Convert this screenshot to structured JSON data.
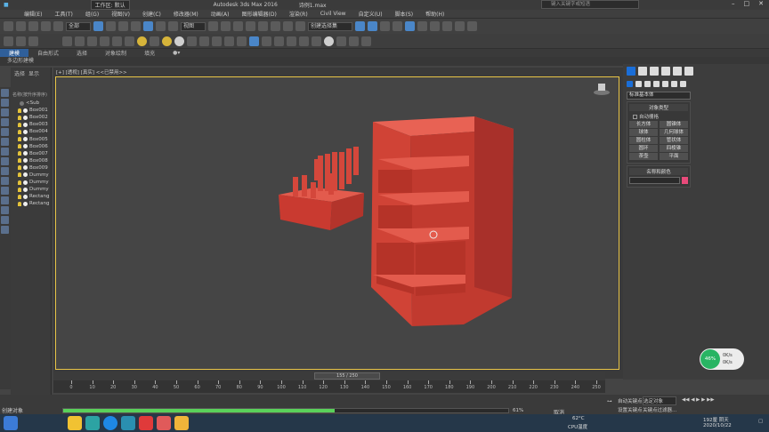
{
  "title_bar": {
    "workspace_label": "工作区: 默认",
    "app_title": "Autodesk 3ds Max 2016",
    "file_name": "诗例1.max",
    "search_placeholder": "键入关键字或短语"
  },
  "menu": [
    "编辑(E)",
    "工具(T)",
    "组(G)",
    "视图(V)",
    "创建(C)",
    "修改器(M)",
    "动画(A)",
    "图形编辑器(D)",
    "渲染(R)",
    "Civil View",
    "自定义(U)",
    "脚本(S)",
    "帮助(H)"
  ],
  "toolbar": {
    "selection_filter": "全部",
    "ref_coord": "视图",
    "named_selection": "创建选择集"
  },
  "ribbon": {
    "tabs": [
      "建模",
      "自由形式",
      "选择",
      "对象绘制",
      "填充"
    ],
    "active_tab": "建模",
    "subtitle": "多边形建模"
  },
  "scene_explorer": {
    "menu": [
      "选择",
      "显示"
    ],
    "column_header": "名称(按升序排序)",
    "items": [
      "<Sub",
      "Box001",
      "Box002",
      "Box003",
      "Box004",
      "Box005",
      "Box006",
      "Box007",
      "Box008",
      "Box009",
      "Dummy",
      "Dummy",
      "Dummy",
      "Rectang",
      "Rectang"
    ]
  },
  "viewport": {
    "label": "[+] [透视] [真实] <<已禁用>>",
    "object_color": "#d9443a",
    "frame_color": "#e8c547"
  },
  "command_panel": {
    "category": "标准基本体",
    "object_type_header": "对象类型",
    "autogrid": "自动栅格",
    "primitives": [
      "长方体",
      "圆锥体",
      "球体",
      "几何球体",
      "圆柱体",
      "管状体",
      "圆环",
      "四棱锥",
      "茶壶",
      "平面"
    ],
    "name_color_header": "名称和颜色",
    "name_color": "#e84a7a"
  },
  "timeline": {
    "slider": "155 / 250",
    "ticks": [
      "0",
      "10",
      "20",
      "30",
      "40",
      "50",
      "60",
      "70",
      "80",
      "90",
      "100",
      "110",
      "120",
      "130",
      "140",
      "150",
      "160",
      "170",
      "180",
      "190",
      "200",
      "210",
      "220",
      "230",
      "240",
      "250"
    ]
  },
  "status": {
    "message": "创建对象",
    "progress": 0.61,
    "progress_text": "61%",
    "cancel_label": "取消",
    "auto_key": "自动关键点",
    "selected_object": "选定对象",
    "set_key": "设置关键点",
    "key_filters": "关键点过滤器..."
  },
  "cpu_monitor": {
    "percent": "46%",
    "up": "0K/s",
    "down": "0K/s",
    "label": "CPU温度",
    "temp": "62°C"
  },
  "taskbar": {
    "weather": "192厘 阴天",
    "date": "2020/10/22"
  }
}
